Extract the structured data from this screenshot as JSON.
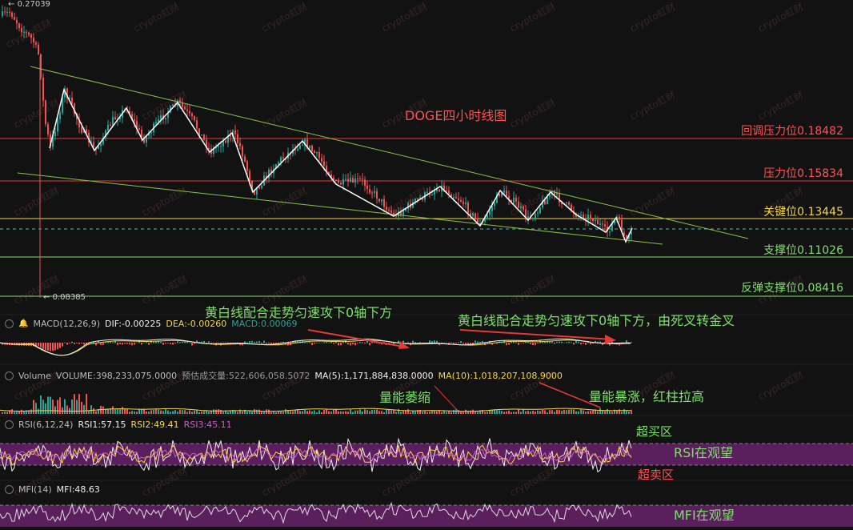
{
  "chart_data": {
    "type": "candlestick",
    "title": "DOGE四小时线图",
    "price_high_label": "0.27039",
    "price_low_label": "0.08385",
    "levels": [
      {
        "label": "回调压力位0.18482",
        "value": 0.18482,
        "color": "#e53935"
      },
      {
        "label": "压力位0.15834",
        "value": 0.15834,
        "color": "#e53935"
      },
      {
        "label": "关键位0.13445",
        "value": 0.13445,
        "color": "#f5d742"
      },
      {
        "label": "支撑位0.11026",
        "value": 0.11026,
        "color": "#7ee06a"
      },
      {
        "label": "反弹支撑位0.08416",
        "value": 0.08416,
        "color": "#7ee06a"
      }
    ],
    "indicators": {
      "macd": {
        "name": "MACD(12,26,9)",
        "dif": "DIF:-0.00225",
        "dea": "DEA:-0.00260",
        "macd": "MACD:0.00069"
      },
      "volume": {
        "name": "Volume",
        "volume": "VOLUME:398,233,075.0000",
        "est": "预估成交量:522,606,058.5072",
        "ma5": "MA(5):1,171,884,838.0000",
        "ma10": "MA(10):1,018,207,108.9000"
      },
      "rsi": {
        "name": "RSI(6,12,24)",
        "rsi1": "RSI1:57.15",
        "rsi2": "RSI2:49.41",
        "rsi3": "RSI3:45.11"
      },
      "mfi": {
        "name": "MFI(14)",
        "mfi": "MFI:48.63"
      }
    }
  },
  "annotations": {
    "macd_note1": "黄白线配合走势匀速攻下0轴下方",
    "macd_note2": "黄白线配合走势匀速攻下0轴下方，由死叉转金叉",
    "vol_note1": "量能萎缩",
    "vol_note2": "量能暴涨，红柱拉高",
    "rsi_overbought": "超买区",
    "rsi_watch": "RSI在观望",
    "rsi_oversold": "超卖区",
    "mfi_watch": "MFI在观望"
  },
  "watermark": "crypto虹财",
  "colors": {
    "up": "#26a69a",
    "down": "#ef5350",
    "wedge": "#8bc34a",
    "zigzag": "#ffffff",
    "rsi_band": "#5b1f5e",
    "mfi_band": "#5b1f5e"
  }
}
